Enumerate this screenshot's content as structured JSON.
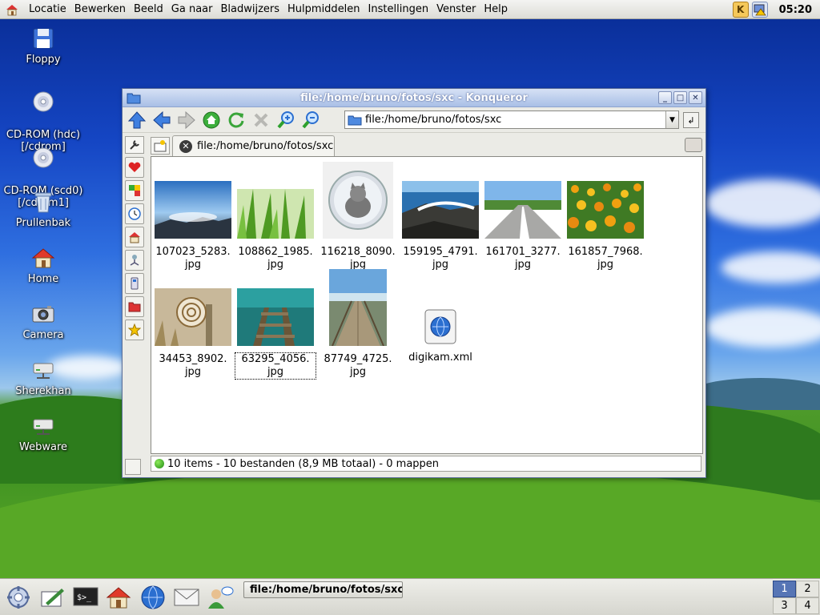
{
  "menubar": {
    "items": [
      "Locatie",
      "Bewerken",
      "Beeld",
      "Ga naar",
      "Bladwijzers",
      "Hulpmiddelen",
      "Instellingen",
      "Venster",
      "Help"
    ],
    "clock": "05:20"
  },
  "desktop": {
    "icons": [
      {
        "label": "Floppy",
        "icon": "floppy-icon"
      },
      {
        "label": "CD-ROM (hdc)\n[/cdrom]",
        "icon": "cdrom-icon"
      },
      {
        "label": "CD-ROM (scd0)\n[/cdrom1]",
        "icon": "cdrom-icon"
      },
      {
        "label": "Prullenbak",
        "icon": "trash-icon"
      },
      {
        "label": "Home",
        "icon": "home-icon"
      },
      {
        "label": "Camera",
        "icon": "camera-icon"
      },
      {
        "label": "Sherekhan",
        "icon": "network-drive-icon"
      },
      {
        "label": "Webware",
        "icon": "network-drive-icon"
      }
    ]
  },
  "window": {
    "title": "file:/home/bruno/fotos/sxc - Konqueror",
    "location": "file:/home/bruno/fotos/sxc",
    "tab_label": "file:/home/bruno/fotos/sxc",
    "files": [
      {
        "line1": "107023_5283.",
        "line2": "jpg"
      },
      {
        "line1": "108862_1985.",
        "line2": "jpg"
      },
      {
        "line1": "116218_8090.",
        "line2": "jpg"
      },
      {
        "line1": "159195_4791.",
        "line2": "jpg"
      },
      {
        "line1": "161701_3277.",
        "line2": "jpg"
      },
      {
        "line1": "161857_7968.",
        "line2": "jpg"
      },
      {
        "line1": "34453_8902.",
        "line2": "jpg"
      },
      {
        "line1": "63295_4056.",
        "line2": "jpg"
      },
      {
        "line1": "87749_4725.",
        "line2": "jpg"
      },
      {
        "line1": "digikam.xml",
        "line2": ""
      }
    ],
    "status": "10 items - 10 bestanden (8,9 MB totaal) - 0 mappen"
  },
  "taskbar": {
    "task_label": "file:/home/bruno/fotos/sxc",
    "desktops": [
      "1",
      "2",
      "3",
      "4"
    ],
    "active_desktop": "1"
  },
  "colors": {
    "accent": "#5675b5",
    "title_gradient_top": "#d6e1f5",
    "title_gradient_bottom": "#a9bfe6"
  }
}
